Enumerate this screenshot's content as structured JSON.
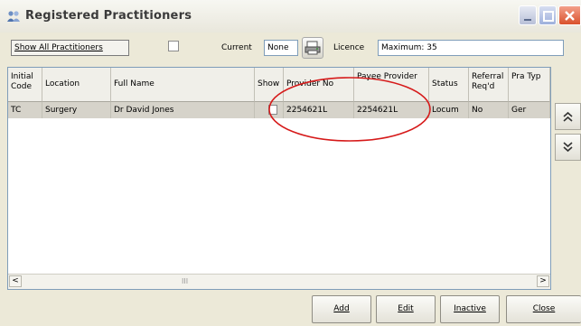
{
  "window": {
    "title": "Registered Practitioners",
    "controls": {
      "minimize": "minimize",
      "maximize": "maximize",
      "close": "close"
    }
  },
  "filters": {
    "show_all_label": "Show All Practitioners",
    "current_label": "Current",
    "current_value": "None",
    "licence_label": "Licence",
    "licence_value": "Maximum: 35"
  },
  "grid": {
    "columns": [
      "Initial Code",
      "Location",
      "Full Name",
      "Show",
      "Provider No",
      "Payee Provider",
      "Status",
      "Referral Req'd",
      "Pra Typ"
    ],
    "rows": [
      {
        "initial_code": "TC",
        "location": "Surgery",
        "full_name": "Dr David Jones",
        "show": "",
        "provider_no": "2254621L",
        "payee_provider": "2254621L",
        "status": "Locum",
        "referral_reqd": "No",
        "practitioner_type": "Ger"
      }
    ],
    "scroll": {
      "left": "<",
      "right": ">",
      "thumb": "III"
    }
  },
  "side_nav": {
    "up": "«",
    "down": "»"
  },
  "buttons": {
    "add": "Add",
    "edit": "Edit",
    "inactive": "Inactive",
    "close": "Close"
  },
  "colors": {
    "window_bg": "#ece9d8",
    "selected_row": "#d6d3ca",
    "annotation": "#d61a1a"
  }
}
